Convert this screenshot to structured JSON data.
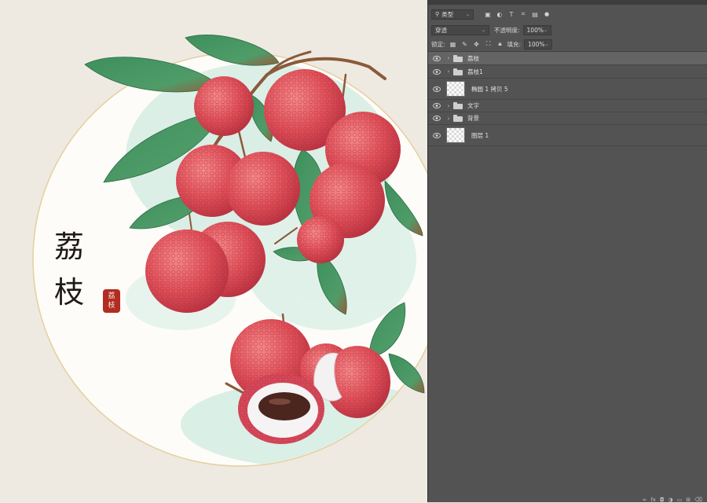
{
  "canvas": {
    "title_chars": [
      "荔",
      "枝"
    ],
    "seal_chars": [
      "荔",
      "枝"
    ]
  },
  "layers_panel": {
    "filter_label": "类型",
    "filter_icons": [
      "image-filter-icon",
      "adjustment-filter-icon",
      "text-filter-icon",
      "shape-filter-icon",
      "smart-object-filter-icon",
      "filter-toggle-icon"
    ],
    "blend_mode": "穿透",
    "opacity_label": "不透明度:",
    "opacity_value": "100%",
    "lock_label": "锁定:",
    "fill_label": "填充:",
    "fill_value": "100%",
    "layers": [
      {
        "name": "荔枝",
        "type": "group",
        "visible": true,
        "selected": true
      },
      {
        "name": "荔枝1",
        "type": "group",
        "visible": true,
        "selected": false
      },
      {
        "name": "椭圆 1 拷贝 5",
        "type": "pixel",
        "visible": true,
        "selected": false
      },
      {
        "name": "文字",
        "type": "group",
        "visible": true,
        "selected": false
      },
      {
        "name": "背景",
        "type": "group",
        "visible": true,
        "selected": false
      },
      {
        "name": "图层 1",
        "type": "pixel",
        "visible": true,
        "selected": false
      }
    ]
  }
}
